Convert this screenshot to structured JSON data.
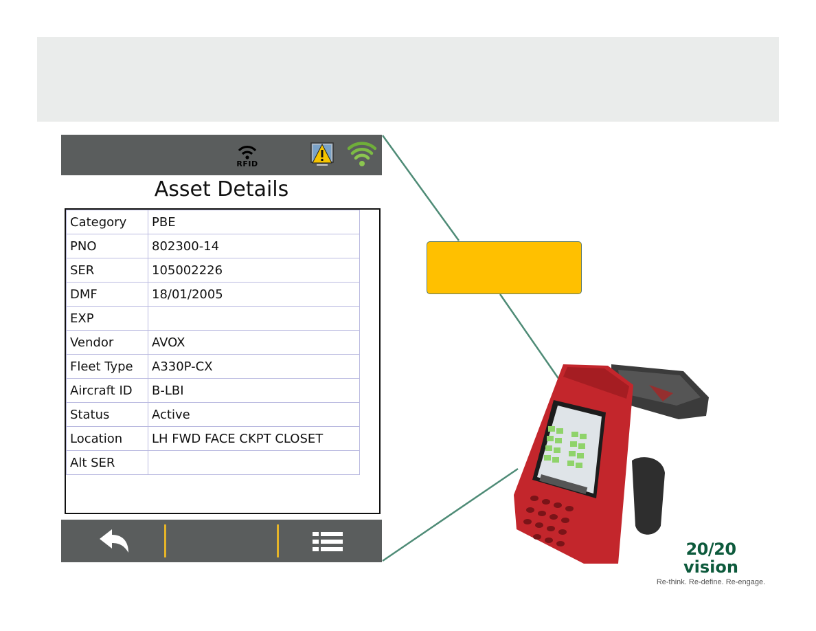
{
  "screen": {
    "title": "Asset Details",
    "status_bar": {
      "rfid_label": "RFID",
      "icons": [
        "rfid-icon",
        "warning-icon",
        "signal-strength-icon"
      ]
    },
    "details": [
      {
        "key": "Category",
        "value": "PBE"
      },
      {
        "key": "PNO",
        "value": "802300-14"
      },
      {
        "key": "SER",
        "value": "105002226"
      },
      {
        "key": "DMF",
        "value": "18/01/2005"
      },
      {
        "key": "EXP",
        "value": ""
      },
      {
        "key": "Vendor",
        "value": "AVOX"
      },
      {
        "key": "Fleet Type",
        "value": "A330P-CX"
      },
      {
        "key": "Aircraft ID",
        "value": "B-LBI"
      },
      {
        "key": "Status",
        "value": "Active"
      },
      {
        "key": "Location",
        "value": "LH FWD FACE CKPT CLOSET"
      },
      {
        "key": "Alt SER",
        "value": ""
      }
    ],
    "bottom_bar": {
      "icons": [
        "back-arrow-icon",
        "list-menu-icon"
      ]
    }
  },
  "callout": {
    "color": "#ffc000"
  },
  "brand": {
    "logo_top": "20/20",
    "logo_bottom": "vision",
    "tagline": "Re-think. Re-define. Re-engage."
  },
  "colors": {
    "bar": "#5a5d5d",
    "accent": "#ffc000",
    "brand_green": "#0d5a3c",
    "separator": "#e5b428"
  }
}
